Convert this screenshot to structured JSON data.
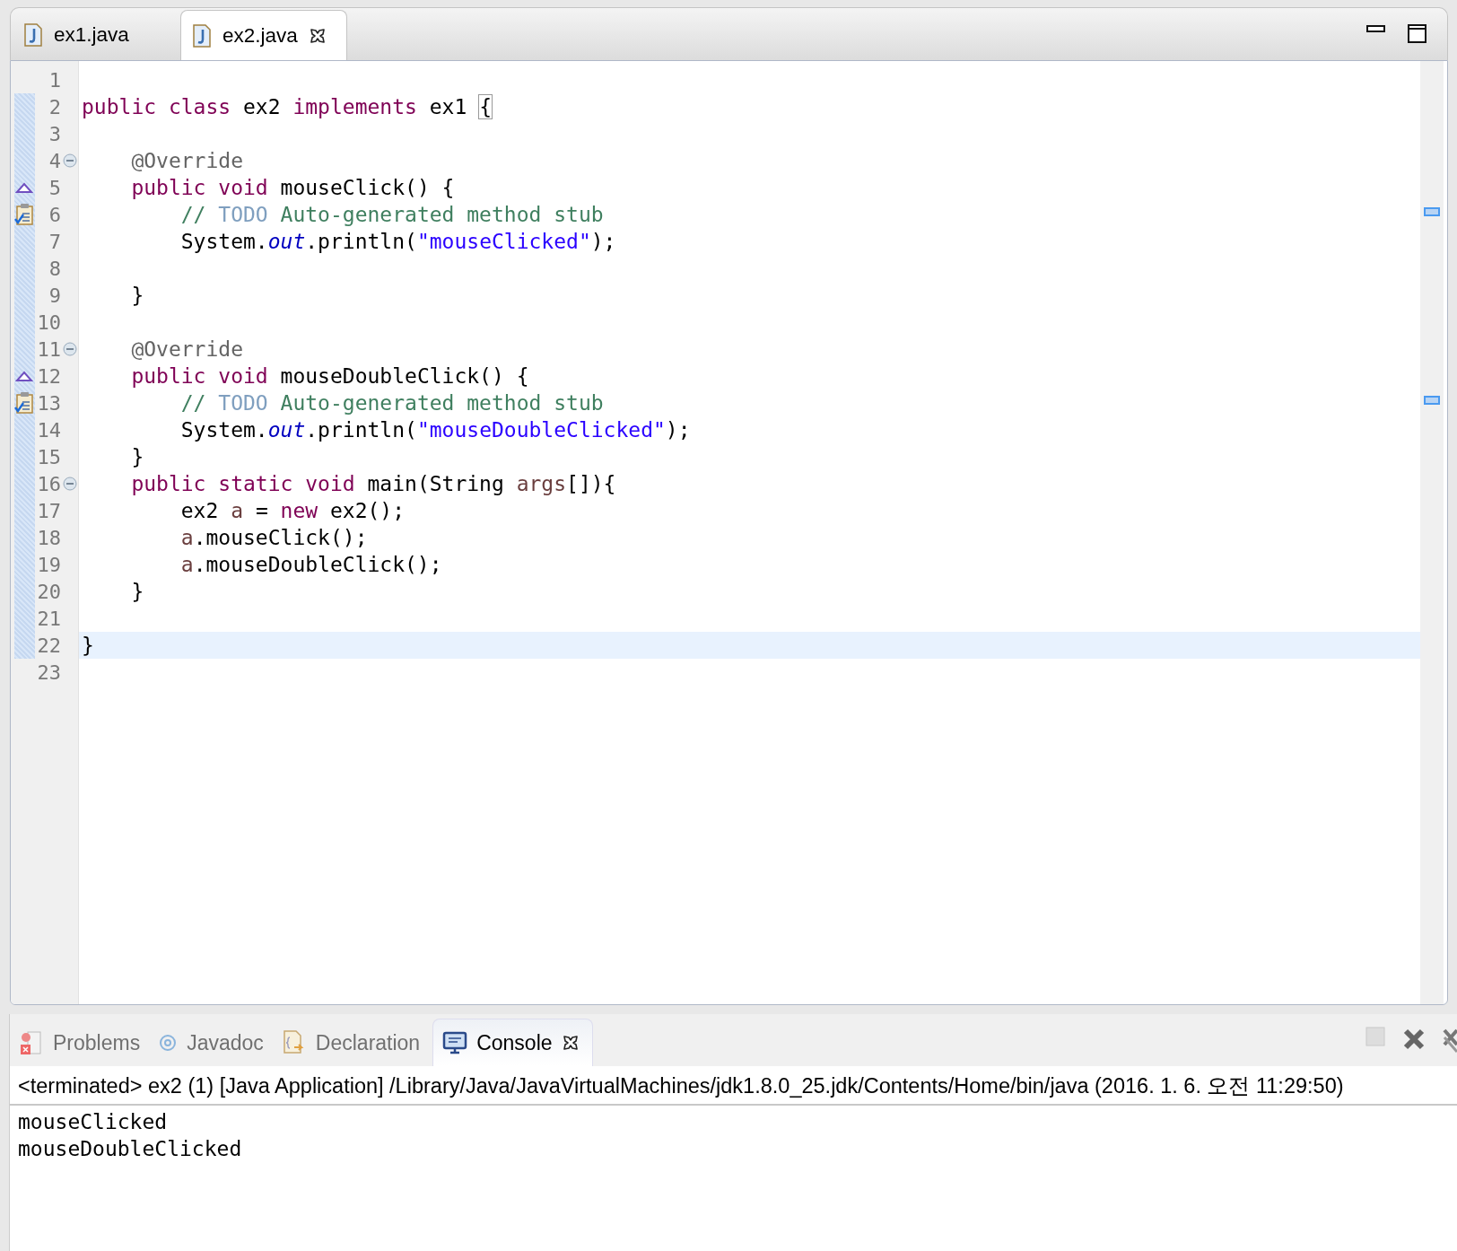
{
  "editor_tabs": [
    {
      "label": "ex1.java",
      "selected": false
    },
    {
      "label": "ex2.java",
      "selected": true
    }
  ],
  "editor": {
    "lines": [
      {
        "number": "1"
      },
      {
        "number": "2",
        "tokens": [
          {
            "kind": "keyword",
            "text": "public class "
          },
          {
            "kind": "plain",
            "text": "ex2 "
          },
          {
            "kind": "keyword",
            "text": "implements "
          },
          {
            "kind": "plain",
            "text": "ex1 "
          },
          {
            "kind": "bracket",
            "text": "{"
          }
        ]
      },
      {
        "number": "3"
      },
      {
        "number": "4",
        "expanded": true,
        "tokens": [
          {
            "kind": "annotation",
            "text": "    @Override"
          }
        ]
      },
      {
        "number": "5",
        "override": true,
        "tokens": [
          {
            "kind": "keyword",
            "text": "    public void "
          },
          {
            "kind": "plain",
            "text": "mouseClick() {"
          }
        ]
      },
      {
        "number": "6",
        "task": true,
        "tokens": [
          {
            "kind": "comment",
            "text": "        // "
          },
          {
            "kind": "todo",
            "text": "TODO"
          },
          {
            "kind": "comment",
            "text": " Auto-generated method stub"
          }
        ]
      },
      {
        "number": "7",
        "tokens": [
          {
            "kind": "plain",
            "text": "        System."
          },
          {
            "kind": "field",
            "text": "out"
          },
          {
            "kind": "plain",
            "text": ".println("
          },
          {
            "kind": "string",
            "text": "\"mouseClicked\""
          },
          {
            "kind": "plain",
            "text": ");"
          }
        ]
      },
      {
        "number": "8"
      },
      {
        "number": "9",
        "tokens": [
          {
            "kind": "plain",
            "text": "    }"
          }
        ]
      },
      {
        "number": "10"
      },
      {
        "number": "11",
        "expanded": true,
        "tokens": [
          {
            "kind": "annotation",
            "text": "    @Override"
          }
        ]
      },
      {
        "number": "12",
        "override": true,
        "tokens": [
          {
            "kind": "keyword",
            "text": "    public void "
          },
          {
            "kind": "plain",
            "text": "mouseDoubleClick() {"
          }
        ]
      },
      {
        "number": "13",
        "task": true,
        "tokens": [
          {
            "kind": "comment",
            "text": "        // "
          },
          {
            "kind": "todo",
            "text": "TODO"
          },
          {
            "kind": "comment",
            "text": " Auto-generated method stub"
          }
        ]
      },
      {
        "number": "14",
        "tokens": [
          {
            "kind": "plain",
            "text": "        System."
          },
          {
            "kind": "field",
            "text": "out"
          },
          {
            "kind": "plain",
            "text": ".println("
          },
          {
            "kind": "string",
            "text": "\"mouseDoubleClicked\""
          },
          {
            "kind": "plain",
            "text": ");"
          }
        ]
      },
      {
        "number": "15",
        "tokens": [
          {
            "kind": "plain",
            "text": "    }"
          }
        ]
      },
      {
        "number": "16",
        "expanded": true,
        "tokens": [
          {
            "kind": "keyword",
            "text": "    public static void "
          },
          {
            "kind": "plain",
            "text": "main(String "
          },
          {
            "kind": "local",
            "text": "args"
          },
          {
            "kind": "plain",
            "text": "[]){"
          }
        ]
      },
      {
        "number": "17",
        "tokens": [
          {
            "kind": "plain",
            "text": "        ex2 "
          },
          {
            "kind": "local",
            "text": "a"
          },
          {
            "kind": "plain",
            "text": " = "
          },
          {
            "kind": "keyword",
            "text": "new "
          },
          {
            "kind": "plain",
            "text": "ex2();"
          }
        ]
      },
      {
        "number": "18",
        "tokens": [
          {
            "kind": "local",
            "text": "        a"
          },
          {
            "kind": "plain",
            "text": ".mouseClick();"
          }
        ]
      },
      {
        "number": "19",
        "tokens": [
          {
            "kind": "local",
            "text": "        a"
          },
          {
            "kind": "plain",
            "text": ".mouseDoubleClick();"
          }
        ]
      },
      {
        "number": "20",
        "tokens": [
          {
            "kind": "plain",
            "text": "    }"
          }
        ]
      },
      {
        "number": "21"
      },
      {
        "number": "22",
        "current": true,
        "tokens": [
          {
            "kind": "plain",
            "text": "}"
          }
        ]
      },
      {
        "number": "23"
      }
    ]
  },
  "bottom_tabs": [
    {
      "label": "Problems",
      "kind": "problems",
      "selected": false
    },
    {
      "label": "Javadoc",
      "kind": "javadoc",
      "selected": false
    },
    {
      "label": "Declaration",
      "kind": "declaration",
      "selected": false
    },
    {
      "label": "Console",
      "kind": "console",
      "selected": true
    }
  ],
  "console": {
    "header": "<terminated> ex2 (1) [Java Application] /Library/Java/JavaVirtualMachines/jdk1.8.0_25.jdk/Contents/Home/bin/java (2016. 1. 6. 오전 11:29:50)",
    "output": [
      "mouseClicked",
      "mouseDoubleClicked"
    ]
  }
}
